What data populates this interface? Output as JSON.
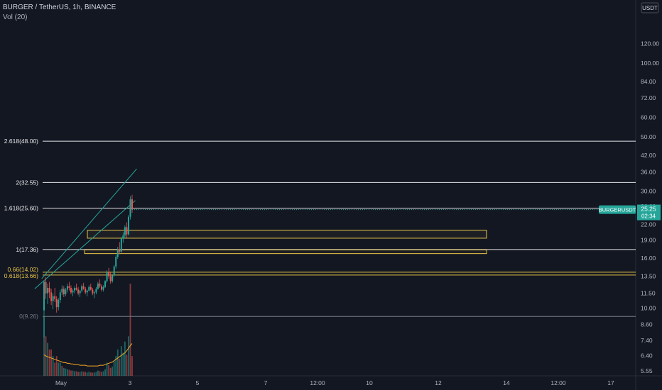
{
  "header": {
    "symbol_line": "BURGER / TetherUS, 1h, BINANCE",
    "volume_indicator": "Vol (20)"
  },
  "chart_data": {
    "type": "candlestick",
    "currency": "USDT",
    "y_scale": "log",
    "ylim": [
      5.3,
      150
    ],
    "y_ticks": [
      "120.00",
      "100.00",
      "84.00",
      "72.00",
      "60.00",
      "50.00",
      "42.00",
      "36.00",
      "30.00",
      "26.00",
      "22.00",
      "19.00",
      "16.00",
      "13.50",
      "11.50",
      "10.00",
      "8.60",
      "7.40",
      "6.40",
      "5.55"
    ],
    "x_ticks": [
      "May",
      "3",
      "5",
      "7",
      "12:00",
      "10",
      "12",
      "14",
      "12:00",
      "17"
    ],
    "last_price": {
      "symbol": "BURGERUSDT",
      "price": "25.25",
      "countdown": "02:34"
    },
    "fib_levels": [
      {
        "label": "2.618(48.00)",
        "value": 48.0
      },
      {
        "label": "2(32.55)",
        "value": 32.55
      },
      {
        "label": "1.618(25.60)",
        "value": 25.6
      },
      {
        "label": "1(17.36)",
        "value": 17.36
      },
      {
        "label": "0.66(14.02)",
        "value": 14.02
      },
      {
        "label": "0.618(13.66)",
        "value": 13.66
      },
      {
        "label": "0(9.26)",
        "value": 9.26
      }
    ],
    "zones": [
      {
        "low": 19.3,
        "high": 20.8
      },
      {
        "low": 16.7,
        "high": 17.3
      }
    ],
    "channel": {
      "upper": [
        [
          10.8,
          13.2
        ],
        [
          26,
          37
        ]
      ],
      "lower": [
        [
          9.9,
          12.0
        ],
        [
          25,
          27.5
        ]
      ]
    },
    "candles": [
      [
        9.8,
        13.0,
        7.6,
        12.8
      ],
      [
        12.8,
        13.4,
        10.9,
        11.5
      ],
      [
        11.5,
        12.6,
        10.4,
        12.1
      ],
      [
        12.1,
        12.8,
        11.0,
        11.6
      ],
      [
        11.6,
        12.0,
        10.3,
        10.7
      ],
      [
        10.7,
        11.5,
        9.9,
        11.2
      ],
      [
        11.2,
        12.1,
        10.6,
        10.9
      ],
      [
        10.9,
        11.2,
        9.6,
        10.1
      ],
      [
        10.1,
        11.0,
        9.8,
        10.8
      ],
      [
        10.8,
        11.9,
        10.5,
        11.6
      ],
      [
        11.6,
        12.4,
        11.3,
        12.0
      ],
      [
        12.0,
        12.3,
        11.1,
        11.4
      ],
      [
        11.4,
        12.1,
        11.2,
        11.9
      ],
      [
        11.9,
        12.6,
        11.6,
        12.3
      ],
      [
        12.3,
        12.8,
        11.8,
        12.1
      ],
      [
        12.1,
        12.4,
        11.4,
        11.6
      ],
      [
        11.6,
        12.0,
        11.2,
        11.8
      ],
      [
        11.8,
        12.3,
        11.5,
        12.1
      ],
      [
        12.1,
        12.6,
        11.8,
        11.9
      ],
      [
        11.9,
        12.2,
        11.3,
        11.5
      ],
      [
        11.5,
        11.9,
        11.1,
        11.8
      ],
      [
        11.8,
        12.5,
        11.6,
        12.3
      ],
      [
        12.3,
        12.7,
        11.9,
        12.0
      ],
      [
        12.0,
        12.2,
        11.4,
        11.6
      ],
      [
        11.6,
        11.9,
        11.2,
        11.8
      ],
      [
        11.8,
        12.4,
        11.7,
        12.2
      ],
      [
        12.2,
        12.6,
        11.8,
        11.9
      ],
      [
        11.9,
        12.1,
        11.3,
        11.5
      ],
      [
        11.5,
        11.8,
        11.0,
        11.6
      ],
      [
        11.6,
        12.2,
        11.4,
        12.0
      ],
      [
        12.0,
        12.8,
        11.9,
        12.6
      ],
      [
        12.6,
        13.1,
        12.1,
        12.3
      ],
      [
        12.3,
        12.5,
        11.7,
        11.9
      ],
      [
        11.9,
        12.4,
        11.7,
        12.2
      ],
      [
        12.2,
        13.0,
        12.1,
        12.9
      ],
      [
        12.9,
        14.3,
        12.7,
        14.0
      ],
      [
        14.0,
        14.6,
        13.2,
        13.5
      ],
      [
        13.5,
        14.0,
        12.6,
        12.9
      ],
      [
        12.9,
        13.8,
        12.7,
        13.6
      ],
      [
        13.6,
        15.0,
        13.4,
        14.8
      ],
      [
        14.8,
        16.5,
        14.5,
        16.2
      ],
      [
        16.2,
        17.8,
        15.9,
        17.4
      ],
      [
        17.4,
        18.6,
        16.6,
        17.0
      ],
      [
        17.0,
        19.5,
        16.8,
        19.2
      ],
      [
        19.2,
        20.4,
        18.5,
        19.8
      ],
      [
        19.8,
        21.8,
        19.2,
        21.4
      ],
      [
        21.4,
        22.4,
        19.4,
        20.0
      ],
      [
        20.0,
        24.0,
        19.8,
        23.6
      ],
      [
        23.6,
        28.6,
        23.0,
        27.8
      ],
      [
        27.8,
        29.0,
        24.5,
        25.25
      ]
    ],
    "volumes": [
      [
        9,
        1
      ],
      [
        6,
        0
      ],
      [
        5,
        1
      ],
      [
        4,
        0
      ],
      [
        4,
        0
      ],
      [
        3,
        1
      ],
      [
        2,
        0
      ],
      [
        3,
        0
      ],
      [
        2,
        1
      ],
      [
        2,
        1
      ],
      [
        1.5,
        0
      ],
      [
        1.2,
        1
      ],
      [
        1.1,
        1
      ],
      [
        1,
        1
      ],
      [
        0.9,
        0
      ],
      [
        0.8,
        0
      ],
      [
        0.8,
        1
      ],
      [
        0.7,
        1
      ],
      [
        0.7,
        0
      ],
      [
        0.6,
        0
      ],
      [
        0.6,
        1
      ],
      [
        0.7,
        1
      ],
      [
        0.6,
        0
      ],
      [
        0.6,
        0
      ],
      [
        0.5,
        1
      ],
      [
        0.6,
        1
      ],
      [
        0.5,
        0
      ],
      [
        0.5,
        0
      ],
      [
        0.5,
        1
      ],
      [
        0.6,
        1
      ],
      [
        0.8,
        1
      ],
      [
        0.7,
        0
      ],
      [
        0.6,
        0
      ],
      [
        0.7,
        1
      ],
      [
        1.0,
        1
      ],
      [
        2.0,
        1
      ],
      [
        1.6,
        0
      ],
      [
        1.2,
        0
      ],
      [
        1.4,
        1
      ],
      [
        2.2,
        1
      ],
      [
        3.0,
        1
      ],
      [
        4.0,
        1
      ],
      [
        2.6,
        0
      ],
      [
        4.5,
        1
      ],
      [
        3.5,
        1
      ],
      [
        5.2,
        1
      ],
      [
        3.2,
        0
      ],
      [
        6.0,
        1
      ],
      [
        14.0,
        0
      ],
      [
        3.0,
        0
      ]
    ],
    "volume_ma": [
      3.2,
      3.0,
      2.9,
      2.8,
      2.7,
      2.6,
      2.5,
      2.4,
      2.3,
      2.2,
      2.1,
      2.0,
      2.0,
      1.9,
      1.9,
      1.8,
      1.8,
      1.7,
      1.7,
      1.7,
      1.6,
      1.6,
      1.6,
      1.6,
      1.5,
      1.5,
      1.5,
      1.5,
      1.5,
      1.5,
      1.5,
      1.6,
      1.6,
      1.6,
      1.7,
      1.8,
      1.9,
      2.0,
      2.1,
      2.3,
      2.5,
      2.7,
      2.9,
      3.1,
      3.3,
      3.5,
      3.8,
      4.2,
      4.6,
      4.9
    ]
  },
  "colors": {
    "background": "#131722",
    "up": "#26a69a",
    "down": "#ef5350",
    "fib_white": "#e6e6e6",
    "fib_yellow": "#e8c547",
    "fib_gray": "#787b86",
    "zone": "#e8c547",
    "channel": "#26a69a",
    "volume_ma": "#f5a623"
  }
}
